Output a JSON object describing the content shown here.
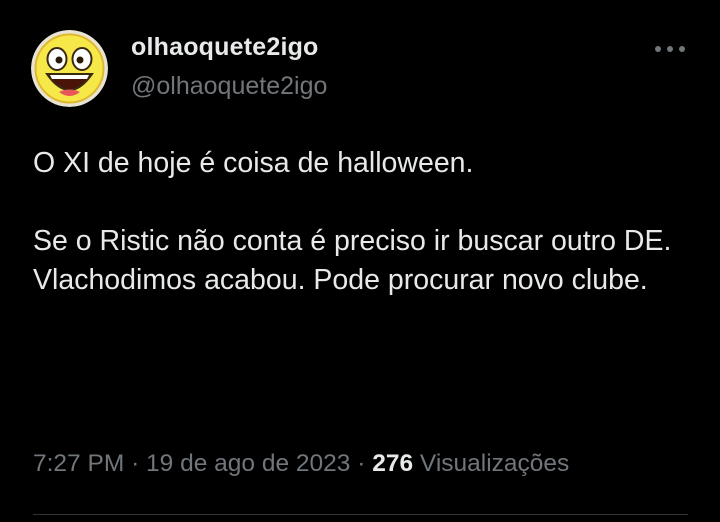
{
  "author": {
    "display_name": "olhaoquete2igo",
    "handle": "@olhaoquete2igo",
    "avatar_icon": "awesome-smiley-face-icon"
  },
  "more_icon": "more-options-icon",
  "tweet": {
    "lines": [
      "O XI de hoje é coisa de halloween.",
      "Se o Ristic não conta é preciso ir buscar outro DE.",
      "Vlachodimos acabou. Pode procurar novo clube."
    ]
  },
  "meta": {
    "time": "7:27 PM",
    "separator": "·",
    "date": "19 de ago de 2023",
    "views_count": "276",
    "views_label": "Visualizações"
  },
  "colors": {
    "background": "#000000",
    "primary_text": "#e7e9ea",
    "secondary_text": "#71767b",
    "divider": "#2f3336"
  }
}
